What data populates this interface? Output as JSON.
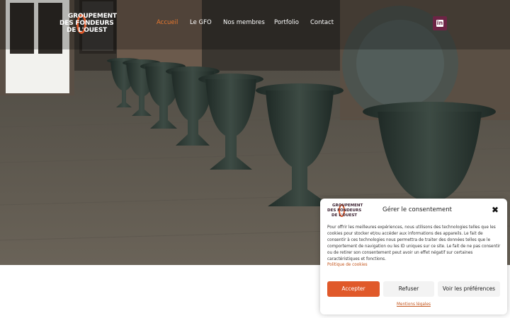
{
  "header": {
    "logo": {
      "line1": "GROUPEMENT",
      "line2": "DES FONDEURS",
      "line3": "DE L'OUEST"
    },
    "nav": [
      {
        "label": "Accueil",
        "active": true
      },
      {
        "label": "Le GFO",
        "active": false
      },
      {
        "label": "Nos membres",
        "active": false
      },
      {
        "label": "Portfolio",
        "active": false
      },
      {
        "label": "Contact",
        "active": false
      }
    ],
    "social": {
      "icon": "linkedin-icon",
      "glyph": "in"
    }
  },
  "hero": {
    "image": "cast-iron-urns-photo"
  },
  "cookie": {
    "logo": {
      "line1": "GROUPEMENT",
      "line2": "DES FONDEURS",
      "line3": "DE L'OUEST"
    },
    "title": "Gérer le consentement",
    "close": "✖",
    "body": "Pour offrir les meilleures expériences, nous utilisons des technologies telles que les cookies pour stocker et/ou accéder aux informations des appareils. Le fait de consentir à ces technologies nous permettra de traiter des données telles que le comportement de navigation ou les ID uniques sur ce site. Le fait de ne pas consentir ou de retirer son consentement peut avoir un effet négatif sur certaines caractéristiques et fonctions.",
    "policy_link": "Politique de cookies",
    "accept": "Accepter",
    "refuse": "Refuser",
    "preferences": "Voir les préférences",
    "legal_link": "Mentions légales"
  },
  "colors": {
    "accent": "#e0592a",
    "nav_active": "#e8782f",
    "linkedin_bg": "#6d2445"
  }
}
